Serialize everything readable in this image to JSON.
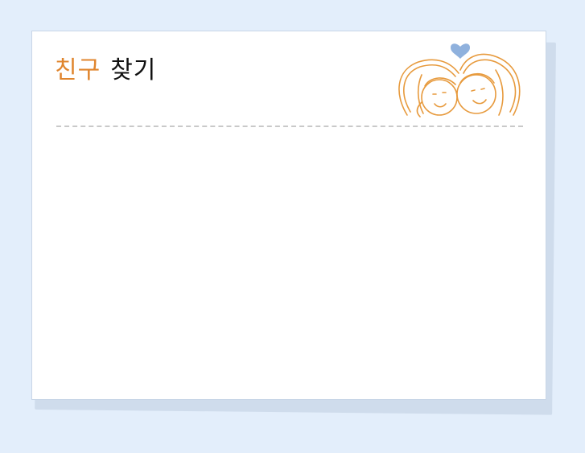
{
  "page": {
    "title_part1": "친구",
    "title_part2": "찾기"
  },
  "illustration": {
    "icon": "two-friends-heart-icon",
    "line_color": "#e79a3d",
    "heart_color": "#8fb1dd"
  },
  "colors": {
    "background": "#e3eefb",
    "card": "#ffffff",
    "accent": "#e0852d",
    "divider": "#c9c9c9"
  }
}
